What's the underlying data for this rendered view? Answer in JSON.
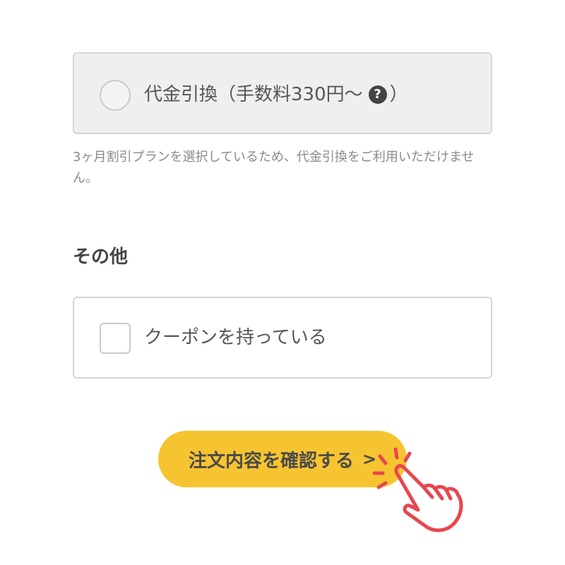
{
  "payment": {
    "cod_label": "代金引換（手数料330円〜",
    "cod_label_close": "）",
    "help_icon_glyph": "?",
    "notice": "3ヶ月割引プランを選択しているため、代金引換をご利用いただけません。"
  },
  "other": {
    "heading": "その他",
    "coupon_label": "クーポンを持っている"
  },
  "confirm": {
    "label": "注文内容を確認する",
    "chevron": ">"
  },
  "colors": {
    "accent": "#f7c431",
    "hand_stroke": "#e8474f"
  }
}
